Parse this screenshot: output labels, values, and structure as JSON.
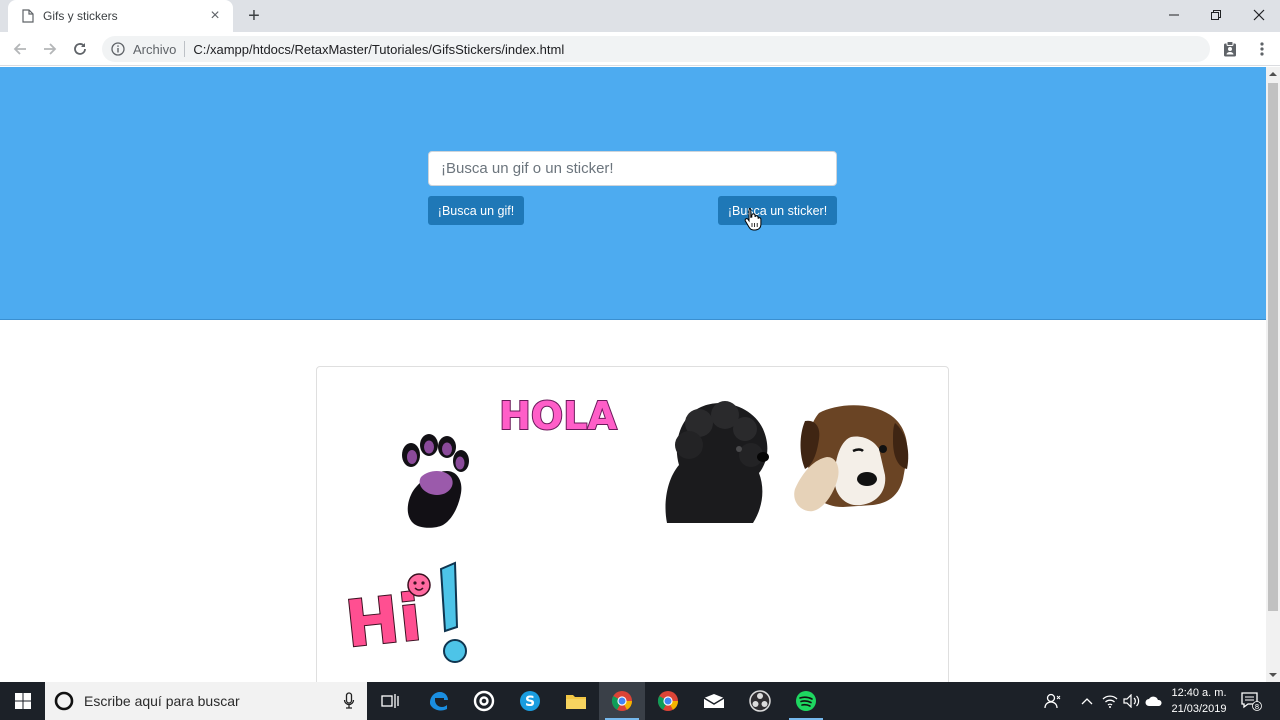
{
  "browser": {
    "tab_title": "Gifs y stickers",
    "tab_close": "×",
    "new_tab": "+",
    "origin_label": "Archivo",
    "url": "C:/xampp/htdocs/RetaxMaster/Tutoriales/GifsStickers/index.html"
  },
  "page": {
    "search_placeholder": "¡Busca un gif o un sticker!",
    "gif_button": "¡Busca un gif!",
    "sticker_button": "¡Busca un sticker!",
    "stickers": [
      {
        "kind": "paw",
        "alt": "purple paw sticker"
      },
      {
        "kind": "text",
        "text": "HOLA",
        "alt": "HOLA sticker"
      },
      {
        "kind": "poodle",
        "alt": "black dog sticker"
      },
      {
        "kind": "beagle",
        "alt": "beagle puppy sticker"
      },
      {
        "kind": "text",
        "text": "Hi!",
        "alt": "Hi! sticker"
      }
    ]
  },
  "taskbar": {
    "search_placeholder": "Escribe aquí para buscar",
    "time": "12:40 a. m.",
    "date": "21/03/2019",
    "notification_count": "8",
    "apps": [
      "task-view",
      "edge",
      "groove",
      "skype",
      "file-explorer",
      "chrome",
      "chrome",
      "mail",
      "obs",
      "spotify"
    ]
  },
  "colors": {
    "hero_bg": "#4dabf0",
    "button_bg": "#1f78b7",
    "taskbar_bg": "#1c2128"
  }
}
